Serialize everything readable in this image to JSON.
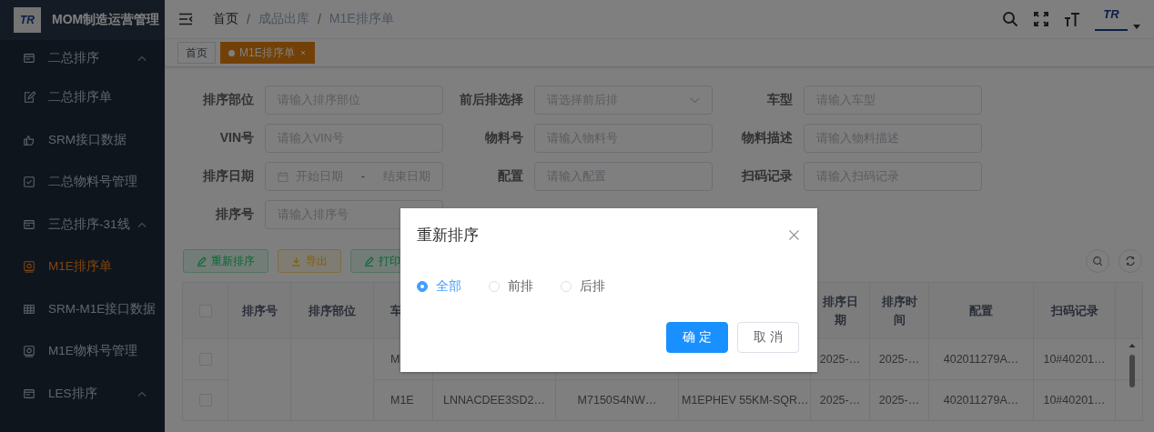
{
  "app": {
    "logo_text": "TR",
    "title": "MOM制造运营管理"
  },
  "sidebar": {
    "items": [
      {
        "kind": "group",
        "label": "二总排序",
        "expanded": true
      },
      {
        "kind": "item",
        "label": "二总排序单",
        "selected": false
      },
      {
        "kind": "item",
        "label": "SRM接口数据",
        "selected": false
      },
      {
        "kind": "item",
        "label": "二总物料号管理",
        "selected": false
      },
      {
        "kind": "group",
        "label": "三总排序-31线",
        "expanded": true
      },
      {
        "kind": "item",
        "label": "M1E排序单",
        "selected": true
      },
      {
        "kind": "item",
        "label": "SRM-M1E接口数据",
        "selected": false
      },
      {
        "kind": "item",
        "label": "M1E物料号管理",
        "selected": false
      },
      {
        "kind": "group",
        "label": "LES排序",
        "expanded": true
      }
    ]
  },
  "header": {
    "breadcrumb": [
      "首页",
      "成品出库",
      "M1E排序单"
    ],
    "separator": "/",
    "avatar_text": "TR"
  },
  "tabs": [
    {
      "label": "首页",
      "selected": false
    },
    {
      "label": "M1E排序单",
      "selected": true
    }
  ],
  "filters": [
    {
      "kind": "text",
      "label": "排序部位",
      "placeholder": "请输入排序部位"
    },
    {
      "kind": "select",
      "label": "前后排选择",
      "placeholder": "请选择前后排"
    },
    {
      "kind": "text",
      "label": "车型",
      "placeholder": "请输入车型"
    },
    {
      "kind": "text",
      "label": "VIN号",
      "placeholder": "请输入VIN号"
    },
    {
      "kind": "text",
      "label": "物料号",
      "placeholder": "请输入物料号"
    },
    {
      "kind": "text",
      "label": "物料描述",
      "placeholder": "请输入物料描述"
    },
    {
      "kind": "daterange",
      "label": "排序日期",
      "start_placeholder": "开始日期",
      "separator": "-",
      "end_placeholder": "结束日期"
    },
    {
      "kind": "text",
      "label": "配置",
      "placeholder": "请输入配置"
    },
    {
      "kind": "text",
      "label": "扫码记录",
      "placeholder": "请输入扫码记录"
    },
    {
      "kind": "text",
      "label": "排序号",
      "placeholder": "请输入排序号"
    }
  ],
  "actions": [
    {
      "kind": "success",
      "label": "重新排序"
    },
    {
      "kind": "warning",
      "label": "导出"
    },
    {
      "kind": "success",
      "label": "打印"
    }
  ],
  "table": {
    "columns": [
      {
        "kind": "checkbox",
        "checked": false
      },
      {
        "kind": "text",
        "label": "排序号"
      },
      {
        "kind": "text",
        "label": "排序部位"
      },
      {
        "kind": "text",
        "label": "车"
      },
      {
        "kind": "blank"
      },
      {
        "kind": "blank"
      },
      {
        "kind": "blank"
      },
      {
        "kind": "text",
        "label": "排序日期"
      },
      {
        "kind": "text",
        "label": "排序时间"
      },
      {
        "kind": "text",
        "label": "配置"
      },
      {
        "kind": "text",
        "label": "扫码记录"
      },
      {
        "kind": "blank"
      }
    ],
    "rows": [
      {
        "checked": false,
        "cells": {
          "3": "M",
          "7": "2025-…",
          "8": "2025-…",
          "9": "402011279A…",
          "10": "10#40201…"
        }
      },
      {
        "checked": false,
        "cells": {
          "3": "M1E",
          "4": "LNNACDEE3SD2…",
          "5": "M7150S4NW…",
          "6": "M1EPHEV 55KM-SQR…",
          "7": "2025-…",
          "8": "2025-…",
          "9": "402011279A…",
          "10": "10#40201…"
        }
      }
    ]
  },
  "dialog": {
    "title": "重新排序",
    "options": [
      {
        "label": "全部",
        "selected": true
      },
      {
        "label": "前排",
        "selected": false
      },
      {
        "label": "后排",
        "selected": false
      }
    ],
    "buttons": [
      {
        "kind": "primary",
        "label": "确 定"
      },
      {
        "kind": "default",
        "label": "取 消"
      }
    ]
  }
}
